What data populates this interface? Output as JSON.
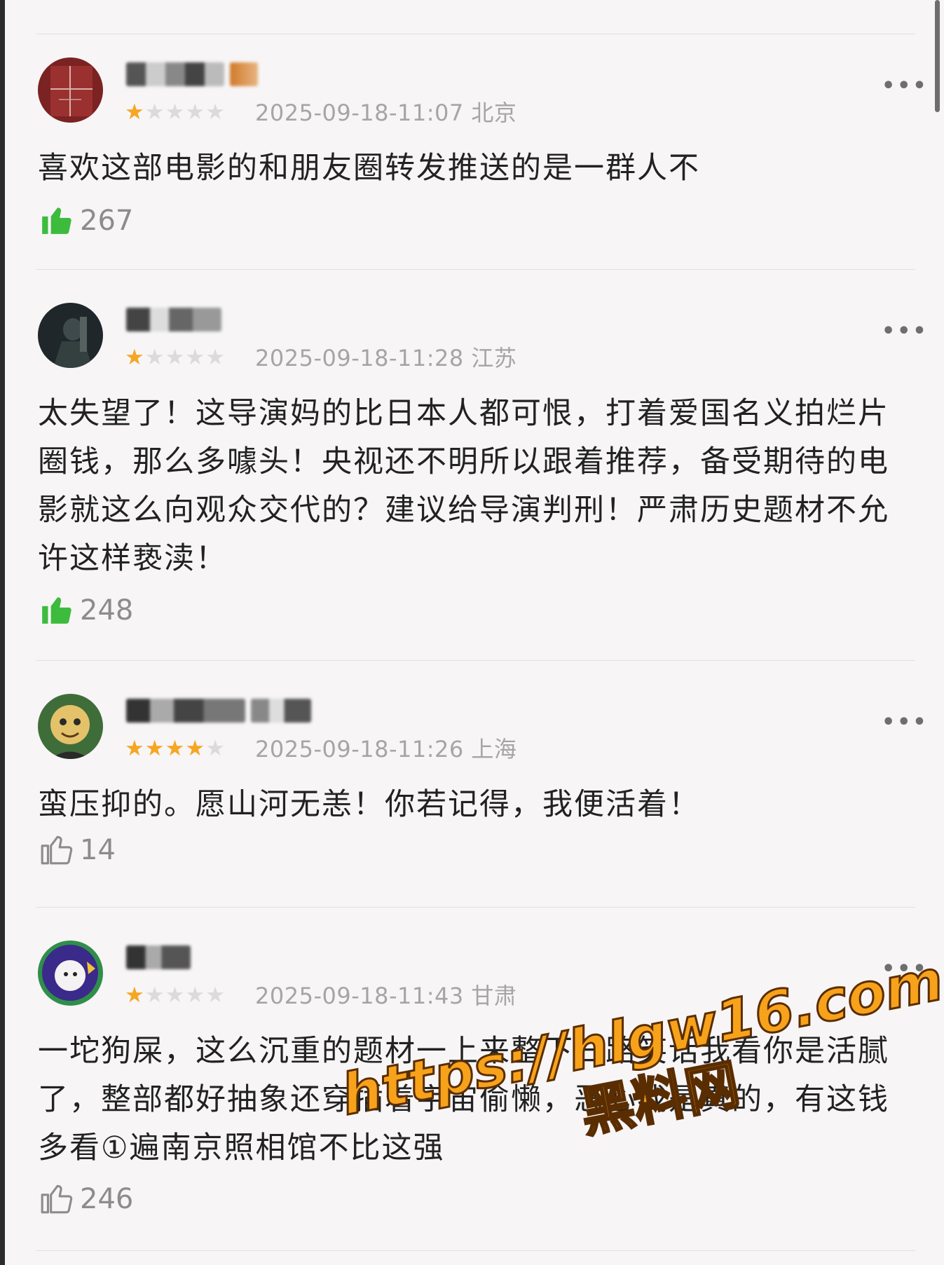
{
  "reviews": [
    {
      "rating": 1,
      "date": "2025-09-18-11:07",
      "location": "北京",
      "text": "喜欢这部电影的和朋友圈转发推送的是一群人不",
      "likes": "267",
      "liked": true,
      "avatar_icon": "dark-red-window-avatar"
    },
    {
      "rating": 1,
      "date": "2025-09-18-11:28",
      "location": "江苏",
      "text": "太失望了！这导演妈的比日本人都可恨，打着爱国名义拍烂片圈钱，那么多噱头！央视还不明所以跟着推荐，备受期待的电影就这么向观众交代的？建议给导演判刑！严肃历史题材不允许这样亵渎！",
      "likes": "248",
      "liked": true,
      "avatar_icon": "dark-figure-avatar"
    },
    {
      "rating": 4,
      "date": "2025-09-18-11:26",
      "location": "上海",
      "text": "蛮压抑的。愿山河无恙！你若记得，我便活着！",
      "likes": "14",
      "liked": false,
      "avatar_icon": "cartoon-face-avatar"
    },
    {
      "rating": 1,
      "date": "2025-09-18-11:43",
      "location": "甘肃",
      "text": "一坨狗屎，这么沉重的题材一上来整下三路笑话我看你是活腻了，整部都好抽象还穿插着宇宙偷懒，恶心我是真的，有这钱多看①遍南京照相馆不比这强",
      "likes": "246",
      "liked": false,
      "avatar_icon": "cartoon-girl-avatar"
    }
  ],
  "watermark": {
    "line1": "https://hlgw16.com",
    "line2": "黑料网"
  },
  "colors": {
    "star_on": "#f5a623",
    "star_off": "#dcdadb",
    "like_active": "#3dbb3d",
    "like_inactive": "#8e8b8d"
  }
}
